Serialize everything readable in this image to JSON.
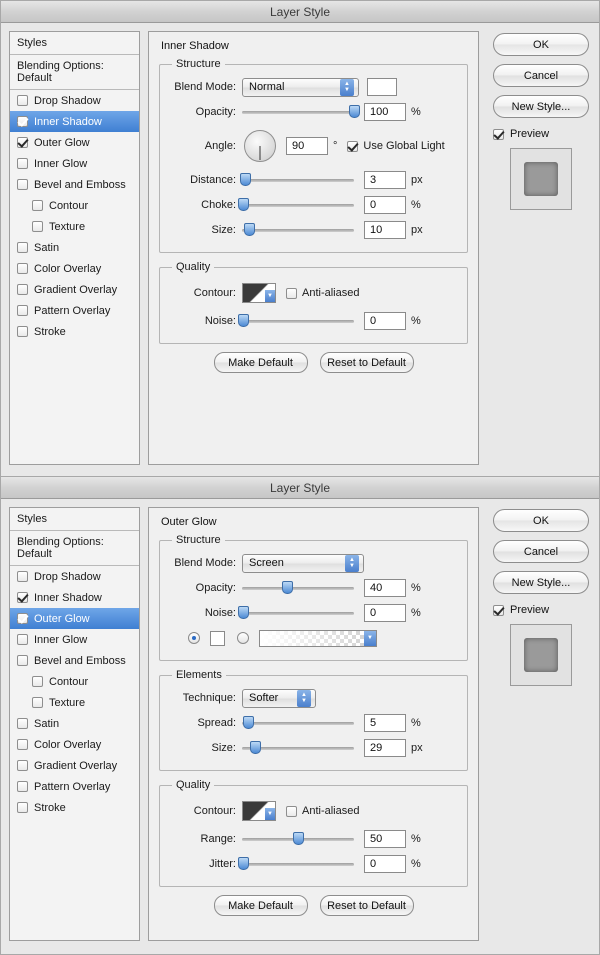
{
  "dialogs": [
    {
      "titlebar": "Layer Style",
      "styles_panel": {
        "header": "Styles",
        "blending_options": "Blending Options: Default",
        "items": [
          {
            "label": "Drop Shadow",
            "checked": false,
            "sub": false,
            "selected": false
          },
          {
            "label": "Inner Shadow",
            "checked": true,
            "sub": false,
            "selected": true
          },
          {
            "label": "Outer Glow",
            "checked": true,
            "sub": false,
            "selected": false
          },
          {
            "label": "Inner Glow",
            "checked": false,
            "sub": false,
            "selected": false
          },
          {
            "label": "Bevel and Emboss",
            "checked": false,
            "sub": false,
            "selected": false
          },
          {
            "label": "Contour",
            "checked": false,
            "sub": true,
            "selected": false
          },
          {
            "label": "Texture",
            "checked": false,
            "sub": true,
            "selected": false
          },
          {
            "label": "Satin",
            "checked": false,
            "sub": false,
            "selected": false
          },
          {
            "label": "Color Overlay",
            "checked": false,
            "sub": false,
            "selected": false
          },
          {
            "label": "Gradient Overlay",
            "checked": false,
            "sub": false,
            "selected": false
          },
          {
            "label": "Pattern Overlay",
            "checked": false,
            "sub": false,
            "selected": false
          },
          {
            "label": "Stroke",
            "checked": false,
            "sub": false,
            "selected": false
          }
        ]
      },
      "panel_title": "Inner Shadow",
      "structure": {
        "legend": "Structure",
        "blend_mode_label": "Blend Mode:",
        "blend_mode_value": "Normal",
        "opacity_label": "Opacity:",
        "opacity_value": "100",
        "opacity_unit": "%",
        "angle_label": "Angle:",
        "angle_value": "90",
        "angle_unit": "°",
        "use_global_light": "Use Global Light",
        "use_global_light_checked": true,
        "distance_label": "Distance:",
        "distance_value": "3",
        "distance_unit": "px",
        "choke_label": "Choke:",
        "choke_value": "0",
        "choke_unit": "%",
        "size_label": "Size:",
        "size_value": "10",
        "size_unit": "px"
      },
      "quality": {
        "legend": "Quality",
        "contour_label": "Contour:",
        "anti_aliased": "Anti-aliased",
        "anti_aliased_checked": false,
        "noise_label": "Noise:",
        "noise_value": "0",
        "noise_unit": "%"
      },
      "buttons": {
        "make_default": "Make Default",
        "reset_to_default": "Reset to Default",
        "ok": "OK",
        "cancel": "Cancel",
        "new_style": "New Style...",
        "preview": "Preview",
        "preview_checked": true
      }
    },
    {
      "titlebar": "Layer Style",
      "styles_panel": {
        "header": "Styles",
        "blending_options": "Blending Options: Default",
        "items": [
          {
            "label": "Drop Shadow",
            "checked": false,
            "sub": false,
            "selected": false
          },
          {
            "label": "Inner Shadow",
            "checked": true,
            "sub": false,
            "selected": false
          },
          {
            "label": "Outer Glow",
            "checked": true,
            "sub": false,
            "selected": true
          },
          {
            "label": "Inner Glow",
            "checked": false,
            "sub": false,
            "selected": false
          },
          {
            "label": "Bevel and Emboss",
            "checked": false,
            "sub": false,
            "selected": false
          },
          {
            "label": "Contour",
            "checked": false,
            "sub": true,
            "selected": false
          },
          {
            "label": "Texture",
            "checked": false,
            "sub": true,
            "selected": false
          },
          {
            "label": "Satin",
            "checked": false,
            "sub": false,
            "selected": false
          },
          {
            "label": "Color Overlay",
            "checked": false,
            "sub": false,
            "selected": false
          },
          {
            "label": "Gradient Overlay",
            "checked": false,
            "sub": false,
            "selected": false
          },
          {
            "label": "Pattern Overlay",
            "checked": false,
            "sub": false,
            "selected": false
          },
          {
            "label": "Stroke",
            "checked": false,
            "sub": false,
            "selected": false
          }
        ]
      },
      "panel_title": "Outer Glow",
      "structure": {
        "legend": "Structure",
        "blend_mode_label": "Blend Mode:",
        "blend_mode_value": "Screen",
        "opacity_label": "Opacity:",
        "opacity_value": "40",
        "opacity_unit": "%",
        "noise_label": "Noise:",
        "noise_value": "0",
        "noise_unit": "%"
      },
      "elements": {
        "legend": "Elements",
        "technique_label": "Technique:",
        "technique_value": "Softer",
        "spread_label": "Spread:",
        "spread_value": "5",
        "spread_unit": "%",
        "size_label": "Size:",
        "size_value": "29",
        "size_unit": "px"
      },
      "quality": {
        "legend": "Quality",
        "contour_label": "Contour:",
        "anti_aliased": "Anti-aliased",
        "anti_aliased_checked": false,
        "range_label": "Range:",
        "range_value": "50",
        "range_unit": "%",
        "jitter_label": "Jitter:",
        "jitter_value": "0",
        "jitter_unit": "%"
      },
      "buttons": {
        "make_default": "Make Default",
        "reset_to_default": "Reset to Default",
        "ok": "OK",
        "cancel": "Cancel",
        "new_style": "New Style...",
        "preview": "Preview",
        "preview_checked": true
      }
    }
  ]
}
